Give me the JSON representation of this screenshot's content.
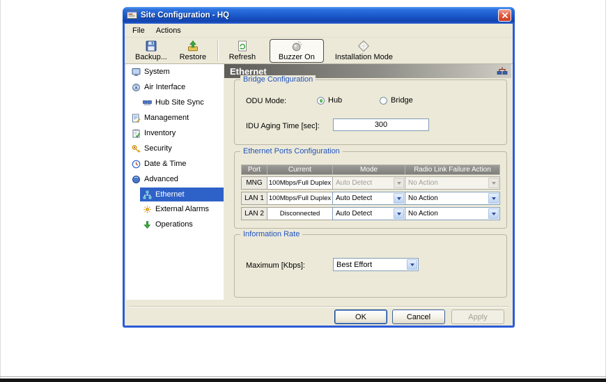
{
  "colors": {
    "titlebar_blue": "#1A57C8",
    "selection_blue": "#2E62C8",
    "group_title_blue": "#2053BE",
    "header_gray_left": "#5E5D59",
    "window_chrome": "#ECE9D8"
  },
  "window": {
    "title": "Site Configuration - HQ",
    "menu": [
      "File",
      "Actions"
    ],
    "toolbar": [
      {
        "label": "Backup...",
        "icon": "backup-icon"
      },
      {
        "label": "Restore",
        "icon": "restore-icon"
      },
      {
        "label": "Refresh",
        "icon": "refresh-icon"
      },
      {
        "label": "Buzzer On",
        "icon": "buzzer-icon",
        "state": "active"
      },
      {
        "label": "Installation Mode",
        "icon": "installation-mode-icon"
      }
    ]
  },
  "sidebar": {
    "items": [
      {
        "label": "System"
      },
      {
        "label": "Air Interface"
      },
      {
        "label": "Hub Site Sync",
        "indent": true
      },
      {
        "label": "Management"
      },
      {
        "label": "Inventory"
      },
      {
        "label": "Security"
      },
      {
        "label": "Date & Time"
      },
      {
        "label": "Advanced"
      },
      {
        "label": "Ethernet",
        "indent": true,
        "selected": true
      },
      {
        "label": "External Alarms",
        "indent": true
      },
      {
        "label": "Operations",
        "indent": true
      }
    ]
  },
  "main": {
    "header": "Ethernet",
    "bridge": {
      "title": "Bridge Configuration",
      "odu_mode_label": "ODU Mode:",
      "hub_label": "Hub",
      "bridge_label": "Bridge",
      "odu_mode_selected": "Hub",
      "aging_label": "IDU Aging Time [sec]:",
      "aging_value": "300"
    },
    "ports": {
      "title": "Ethernet Ports Configuration",
      "headers": [
        "Port",
        "Current",
        "Mode",
        "Radio Link Failure Action"
      ],
      "rows": [
        {
          "port": "MNG",
          "current": "100Mbps/Full Duplex",
          "mode": "Auto Detect",
          "action": "No Action",
          "enabled": false
        },
        {
          "port": "LAN 1",
          "current": "100Mbps/Full Duplex",
          "mode": "Auto Detect",
          "action": "No Action",
          "enabled": true
        },
        {
          "port": "LAN 2",
          "current": "Disconnected",
          "mode": "Auto Detect",
          "action": "No Action",
          "enabled": true
        }
      ]
    },
    "info_rate": {
      "title": "Information Rate",
      "max_label": "Maximum [Kbps]:",
      "max_value": "Best Effort"
    }
  },
  "footer": {
    "ok": "OK",
    "cancel": "Cancel",
    "apply": "Apply"
  }
}
